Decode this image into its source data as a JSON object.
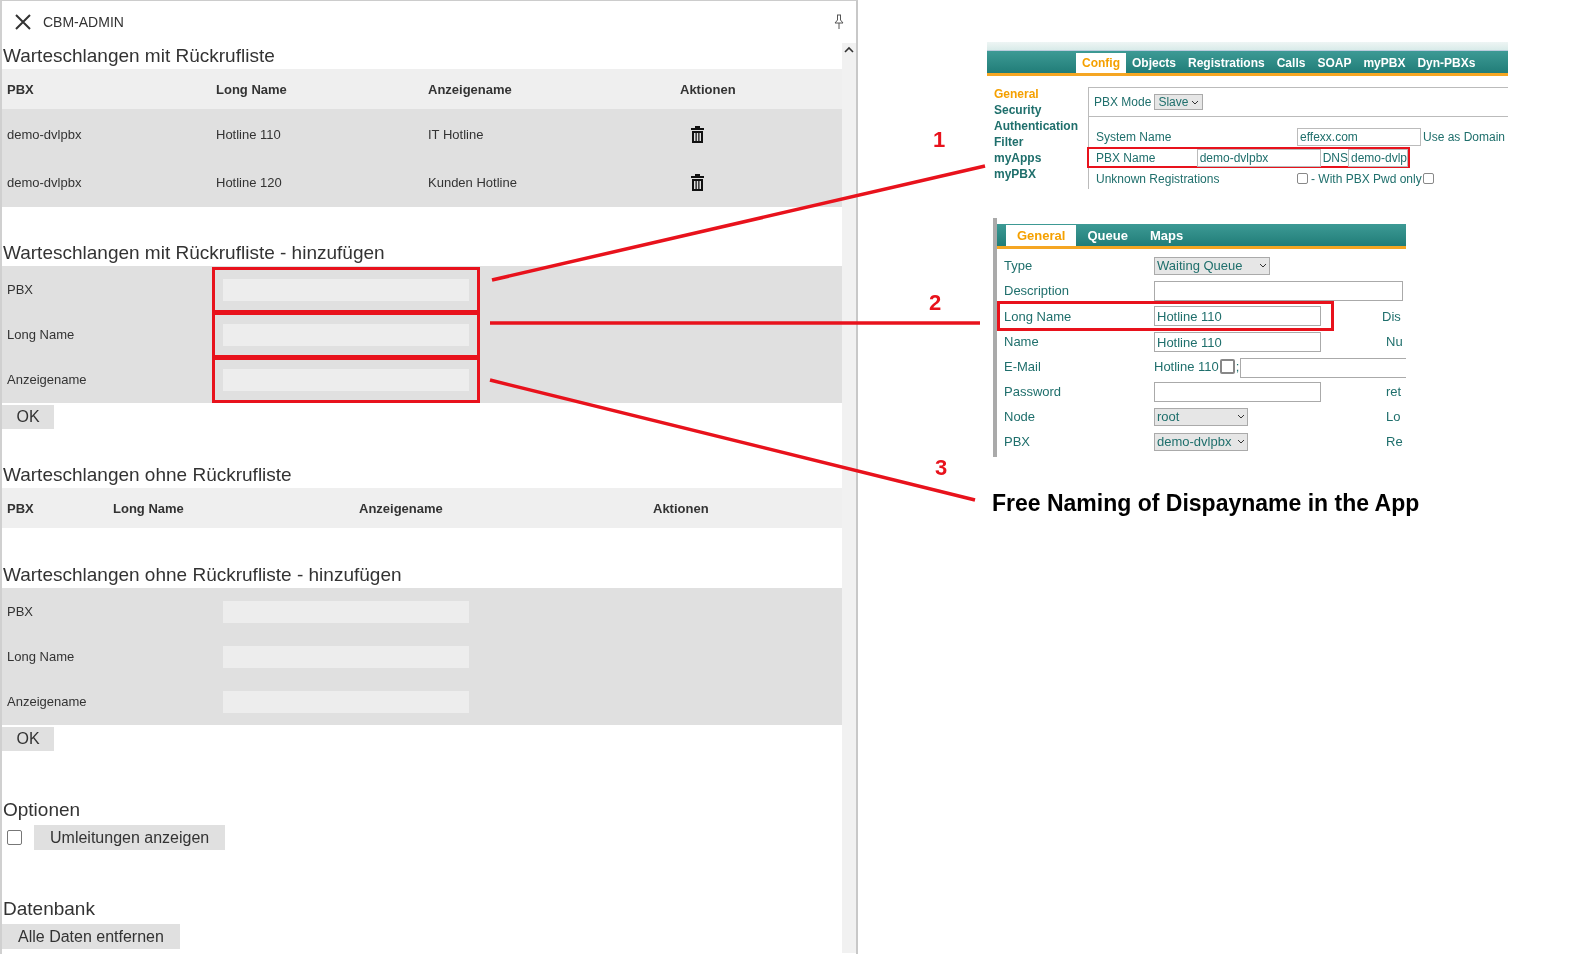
{
  "panel": {
    "title": "CBM-ADMIN",
    "sections": [
      {
        "kind": "table",
        "heading": "Warteschlangen mit Rückrufliste",
        "columns": [
          "PBX",
          "Long Name",
          "Anzeigename",
          "Aktionen"
        ],
        "rows": [
          {
            "pbx": "demo-dvlpbx",
            "long_name": "Hotline 110",
            "display_name": "IT Hotline"
          },
          {
            "pbx": "demo-dvlpbx",
            "long_name": "Hotline 120",
            "display_name": "Kunden Hotline"
          }
        ]
      },
      {
        "kind": "form",
        "heading": "Warteschlangen mit Rückrufliste - hinzufügen",
        "fields": [
          {
            "label": "PBX",
            "highlighted": true
          },
          {
            "label": "Long Name",
            "highlighted": true
          },
          {
            "label": "Anzeigename",
            "highlighted": true
          }
        ],
        "button": "OK"
      },
      {
        "kind": "table",
        "heading": "Warteschlangen ohne Rückrufliste",
        "columns": [
          "PBX",
          "Long Name",
          "Anzeigename",
          "Aktionen"
        ]
      },
      {
        "kind": "form",
        "heading": "Warteschlangen ohne Rückrufliste - hinzufügen",
        "fields": [
          {
            "label": "PBX",
            "highlighted": false
          },
          {
            "label": "Long Name",
            "highlighted": false
          },
          {
            "label": "Anzeigename",
            "highlighted": false
          }
        ],
        "button": "OK"
      },
      {
        "kind": "option",
        "heading": "Optionen",
        "checked": false,
        "button": "Umleitungen anzeigen"
      },
      {
        "kind": "action",
        "heading": "Datenbank",
        "button": "Alle Daten entfernen"
      }
    ]
  },
  "inset_1": {
    "tabs": [
      {
        "label": "Config",
        "selected": true
      },
      {
        "label": "Objects",
        "selected": false
      },
      {
        "label": "Registrations",
        "selected": false
      },
      {
        "label": "Calls",
        "selected": false
      },
      {
        "label": "SOAP",
        "selected": false
      },
      {
        "label": "myPBX",
        "selected": false
      },
      {
        "label": "Dyn-PBXs",
        "selected": false
      }
    ],
    "nav": [
      {
        "label": "General",
        "selected": true
      },
      {
        "label": "Security",
        "selected": false
      },
      {
        "label": "Authentication",
        "selected": false
      },
      {
        "label": "Filter",
        "selected": false
      },
      {
        "label": "myApps",
        "selected": false
      },
      {
        "label": "myPBX",
        "selected": false
      }
    ],
    "mode": {
      "label": "PBX Mode",
      "value": "Slave"
    },
    "rows": [
      {
        "kind": "input",
        "label": "System Name",
        "value": "effexx.com",
        "note": "Use as Domain",
        "highlighted": false
      },
      {
        "kind": "input",
        "label": "PBX Name",
        "value": "demo-dvlpbx",
        "note": "DNS",
        "note_value": "demo-dvlp",
        "highlighted": true
      },
      {
        "kind": "checkbox",
        "label": "Unknown Registrations",
        "text": "- With PBX Pwd only",
        "checked": false,
        "checked_2": false,
        "highlighted": false
      }
    ]
  },
  "inset_2": {
    "tabs": [
      {
        "label": "General",
        "selected": true
      },
      {
        "label": "Queue",
        "selected": false
      },
      {
        "label": "Maps",
        "selected": false
      }
    ],
    "rows": [
      {
        "kind": "select",
        "label": "Type",
        "value": "Waiting Queue",
        "highlighted": false
      },
      {
        "kind": "wide_input",
        "label": "Description",
        "highlighted": false
      },
      {
        "kind": "input",
        "label": "Long Name",
        "value": "Hotline 110",
        "side": "Dis",
        "highlighted": true
      },
      {
        "kind": "input",
        "label": "Name",
        "value": "Hotline 110",
        "side": "Nu",
        "highlighted": false
      },
      {
        "kind": "email",
        "label": "E-Mail",
        "value": "Hotline 110",
        "checked": false,
        "sep": ";",
        "highlighted": false
      },
      {
        "kind": "input",
        "label": "Password",
        "value": "",
        "side": "ret",
        "highlighted": false
      },
      {
        "kind": "select",
        "label": "Node",
        "value": "root",
        "side": "Lo",
        "highlighted": false
      },
      {
        "kind": "select",
        "label": "PBX",
        "value": "demo-dvlpbx",
        "side": "Re",
        "highlighted": false
      }
    ]
  },
  "annotations": [
    {
      "number": "1"
    },
    {
      "number": "2"
    },
    {
      "number": "3"
    }
  ],
  "caption": "Free Naming of Dispayname in the App"
}
